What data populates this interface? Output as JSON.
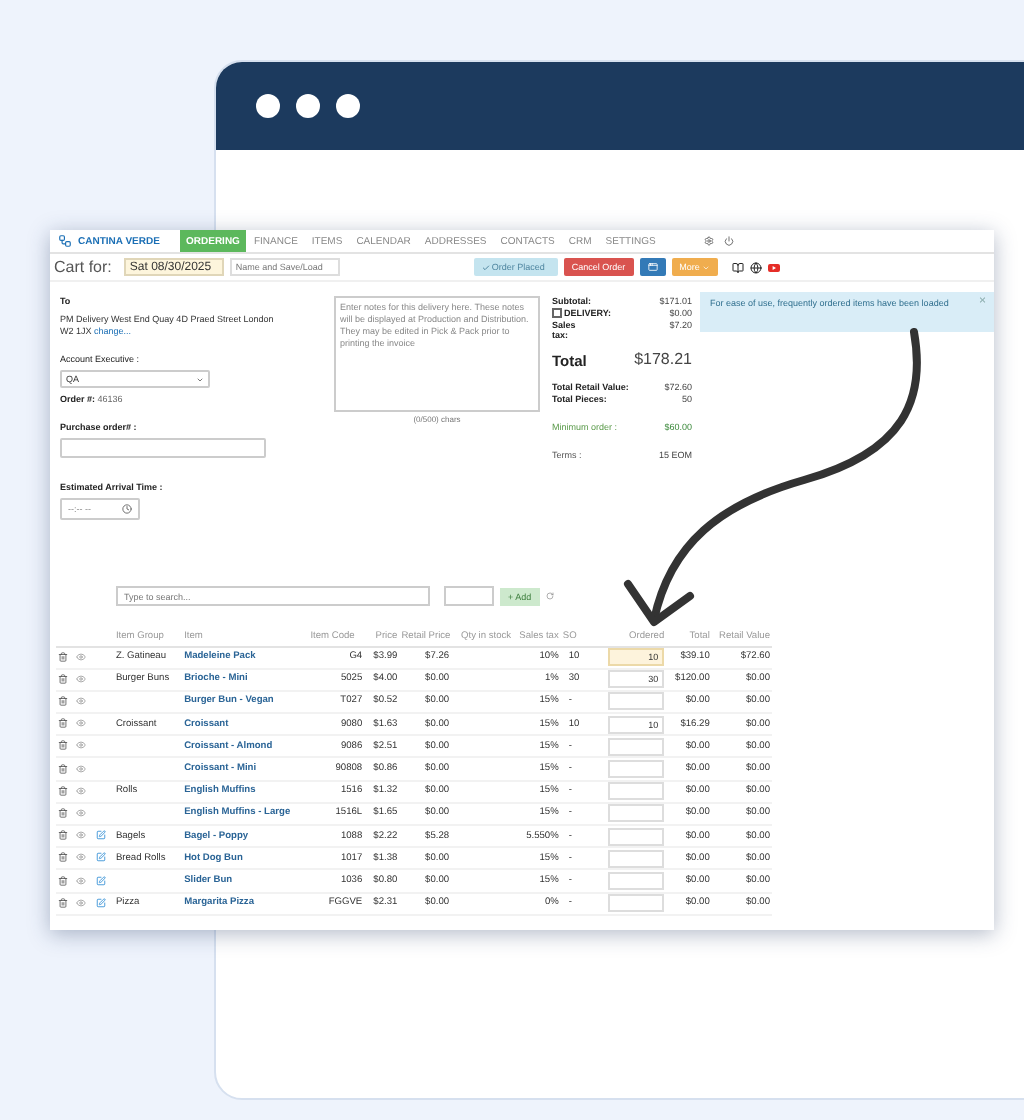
{
  "app": {
    "brand": "CANTINA VERDE",
    "nav": [
      {
        "label": "ORDERING",
        "selected": true
      },
      {
        "label": "FINANCE",
        "selected": false
      },
      {
        "label": "ITEMS",
        "selected": false
      },
      {
        "label": "CALENDAR",
        "selected": false
      },
      {
        "label": "ADDRESSES",
        "selected": false
      },
      {
        "label": "CONTACTS",
        "selected": false
      },
      {
        "label": "CRM",
        "selected": false
      },
      {
        "label": "SETTINGS",
        "selected": false
      }
    ],
    "toolbar": {
      "cart_label": "Cart for:",
      "date": "Sat 08/30/2025",
      "name_placeholder": "Name and Save/Load",
      "buttons": [
        {
          "kind": "placed",
          "label": "Order Placed",
          "disabled": true
        },
        {
          "kind": "cancel",
          "label": "Cancel Order",
          "disabled": false
        },
        {
          "kind": "icon",
          "disabled": false
        },
        {
          "kind": "more",
          "label": "More",
          "disabled": false
        }
      ]
    },
    "alert": {
      "text": "For ease of use, frequently ordered items have been loaded",
      "close": "×"
    },
    "delivery": {
      "to_label": "To",
      "address": "PM Delivery West End Quay 4D Praed Street London W2 1JX",
      "change_link": "change...",
      "account_label": "Account Executive :",
      "account_value": "QA",
      "order_label": "Order #:",
      "order_number": "46136",
      "po_label": "Purchase order# :",
      "eta_label": "Estimated Arrival Time :",
      "eta_placeholder": "--:-- --"
    },
    "notes": {
      "placeholder": "Enter notes for this delivery here. These notes will be displayed at Production and Distribution. They may be edited in Pick & Pack prior to printing the invoice",
      "counter": "(0/500) chars"
    },
    "summary": {
      "subtotal_label": "Subtotal:",
      "subtotal": "$171.01",
      "delivery_label": "DELIVERY:",
      "delivery_checked": false,
      "delivery": "$0.00",
      "tax_label": "Sales tax:",
      "tax": "$7.20",
      "total_label": "Total",
      "total": "$178.21",
      "retail_label": "Total Retail Value:",
      "retail": "$72.60",
      "pieces_label": "Total Pieces:",
      "pieces": "50",
      "minimum_label": "Minimum order :",
      "minimum": "$60.00",
      "terms_label": "Terms :",
      "terms": "15 EOM"
    },
    "search": {
      "placeholder": "Type to search...",
      "add_label": "+ Add",
      "add_disabled": true
    },
    "table": {
      "columns": [
        "Item Group",
        "Item",
        "Item Code",
        "Price",
        "Retail Price",
        "Qty in stock",
        "Sales tax",
        "SO",
        "Ordered",
        "Total",
        "Retail Value"
      ],
      "rows": [
        {
          "group": "Z. Gatineau",
          "item": "Madeleine Pack",
          "code": "G4",
          "price": "$3.99",
          "retail_price": "$7.26",
          "tax": "10%",
          "so": "10",
          "ordered": "10",
          "highlighted": true,
          "editable": false,
          "total": "$39.10",
          "retail_value": "$72.60"
        },
        {
          "group": "Burger Buns",
          "item": "Brioche - Mini",
          "code": "5025",
          "price": "$4.00",
          "retail_price": "$0.00",
          "tax": "1%",
          "so": "30",
          "ordered": "30",
          "highlighted": false,
          "editable": false,
          "total": "$120.00",
          "retail_value": "$0.00"
        },
        {
          "item": "Burger Bun - Vegan",
          "code": "T027",
          "price": "$0.52",
          "retail_price": "$0.00",
          "tax": "15%",
          "so": "-",
          "highlighted": false,
          "editable": false,
          "total": "$0.00",
          "retail_value": "$0.00"
        },
        {
          "group": "Croissant",
          "item": "Croissant",
          "code": "9080",
          "price": "$1.63",
          "retail_price": "$0.00",
          "tax": "15%",
          "so": "10",
          "ordered": "10",
          "highlighted": false,
          "editable": false,
          "total": "$16.29",
          "retail_value": "$0.00"
        },
        {
          "item": "Croissant - Almond",
          "code": "9086",
          "price": "$2.51",
          "retail_price": "$0.00",
          "tax": "15%",
          "so": "-",
          "highlighted": false,
          "editable": false,
          "total": "$0.00",
          "retail_value": "$0.00"
        },
        {
          "item": "Croissant - Mini",
          "code": "90808",
          "price": "$0.86",
          "retail_price": "$0.00",
          "tax": "15%",
          "so": "-",
          "highlighted": false,
          "editable": false,
          "total": "$0.00",
          "retail_value": "$0.00"
        },
        {
          "group": "Rolls",
          "item": "English Muffins",
          "code": "1516",
          "price": "$1.32",
          "retail_price": "$0.00",
          "tax": "15%",
          "so": "-",
          "highlighted": false,
          "editable": false,
          "total": "$0.00",
          "retail_value": "$0.00"
        },
        {
          "item": "English Muffins - Large",
          "code": "1516L",
          "price": "$1.65",
          "retail_price": "$0.00",
          "tax": "15%",
          "so": "-",
          "highlighted": false,
          "editable": false,
          "total": "$0.00",
          "retail_value": "$0.00"
        },
        {
          "group": "Bagels",
          "item": "Bagel - Poppy",
          "code": "1088",
          "price": "$2.22",
          "retail_price": "$5.28",
          "tax": "5.550%",
          "so": "-",
          "highlighted": false,
          "editable": true,
          "total": "$0.00",
          "retail_value": "$0.00"
        },
        {
          "group": "Bread Rolls",
          "item": "Hot Dog Bun",
          "code": "1017",
          "price": "$1.38",
          "retail_price": "$0.00",
          "tax": "15%",
          "so": "-",
          "highlighted": false,
          "editable": true,
          "total": "$0.00",
          "retail_value": "$0.00"
        },
        {
          "item": "Slider Bun",
          "code": "1036",
          "price": "$0.80",
          "retail_price": "$0.00",
          "tax": "15%",
          "so": "-",
          "highlighted": false,
          "editable": true,
          "total": "$0.00",
          "retail_value": "$0.00"
        },
        {
          "group": "Pizza",
          "item": "Margarita Pizza",
          "code": "FGGVE",
          "price": "$2.31",
          "retail_price": "$0.00",
          "tax": "0%",
          "so": "-",
          "highlighted": false,
          "editable": true,
          "total": "$0.00",
          "retail_value": "$0.00"
        }
      ]
    }
  }
}
